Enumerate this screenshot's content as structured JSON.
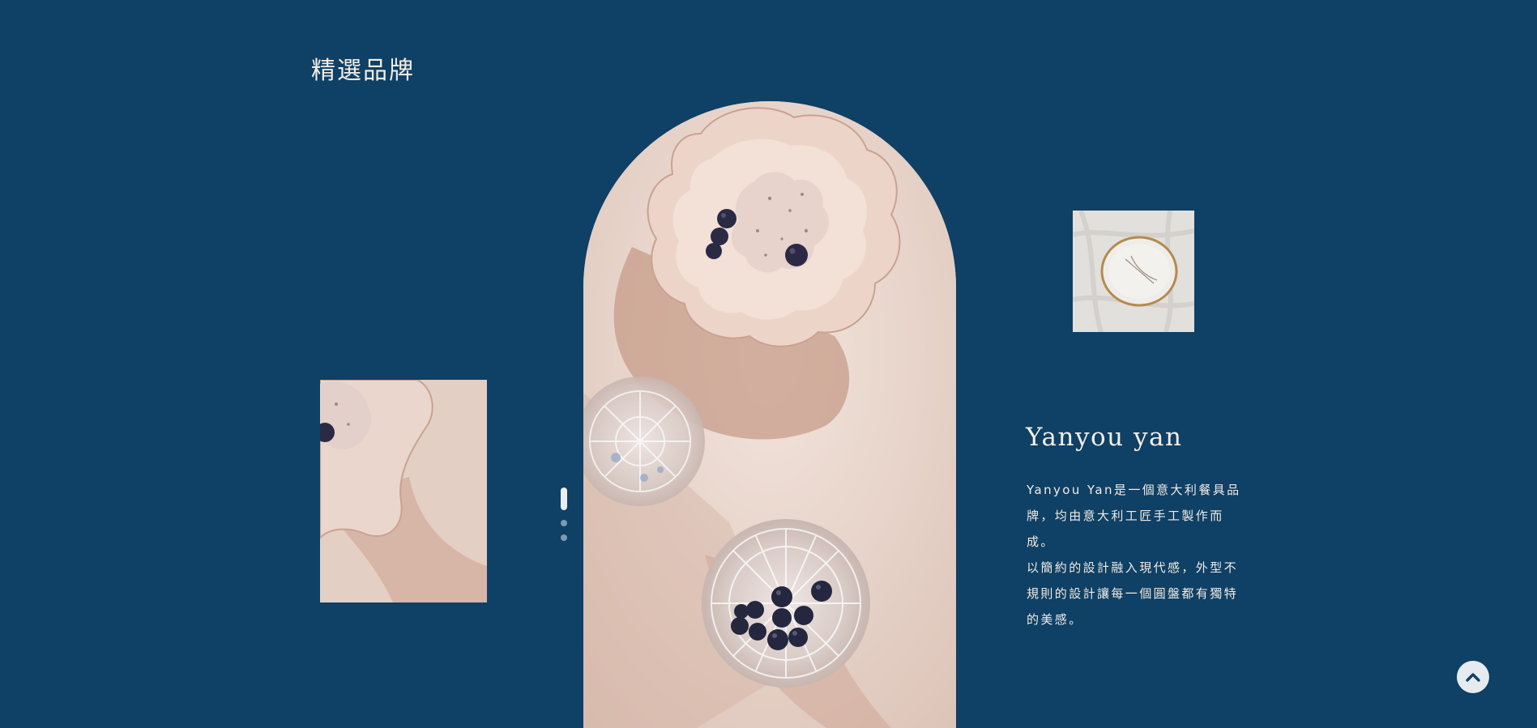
{
  "section": {
    "title": "精選品牌"
  },
  "brand": {
    "name": "Yanyou yan",
    "description": [
      "Yanyou Yan是一個意大利餐具品牌，均由意大利工匠手工製作而成。",
      "以簡約的設計融入現代感，外型不規則的設計讓每一個圓盤都有獨特的美感。"
    ]
  },
  "carousel": {
    "slides": 3,
    "active_index": 0
  },
  "icons": {
    "scroll_top": "chevron-up-icon"
  },
  "colors": {
    "background": "#0f4065",
    "text": "#f1ebe4",
    "accent": "#e6ebf0"
  }
}
